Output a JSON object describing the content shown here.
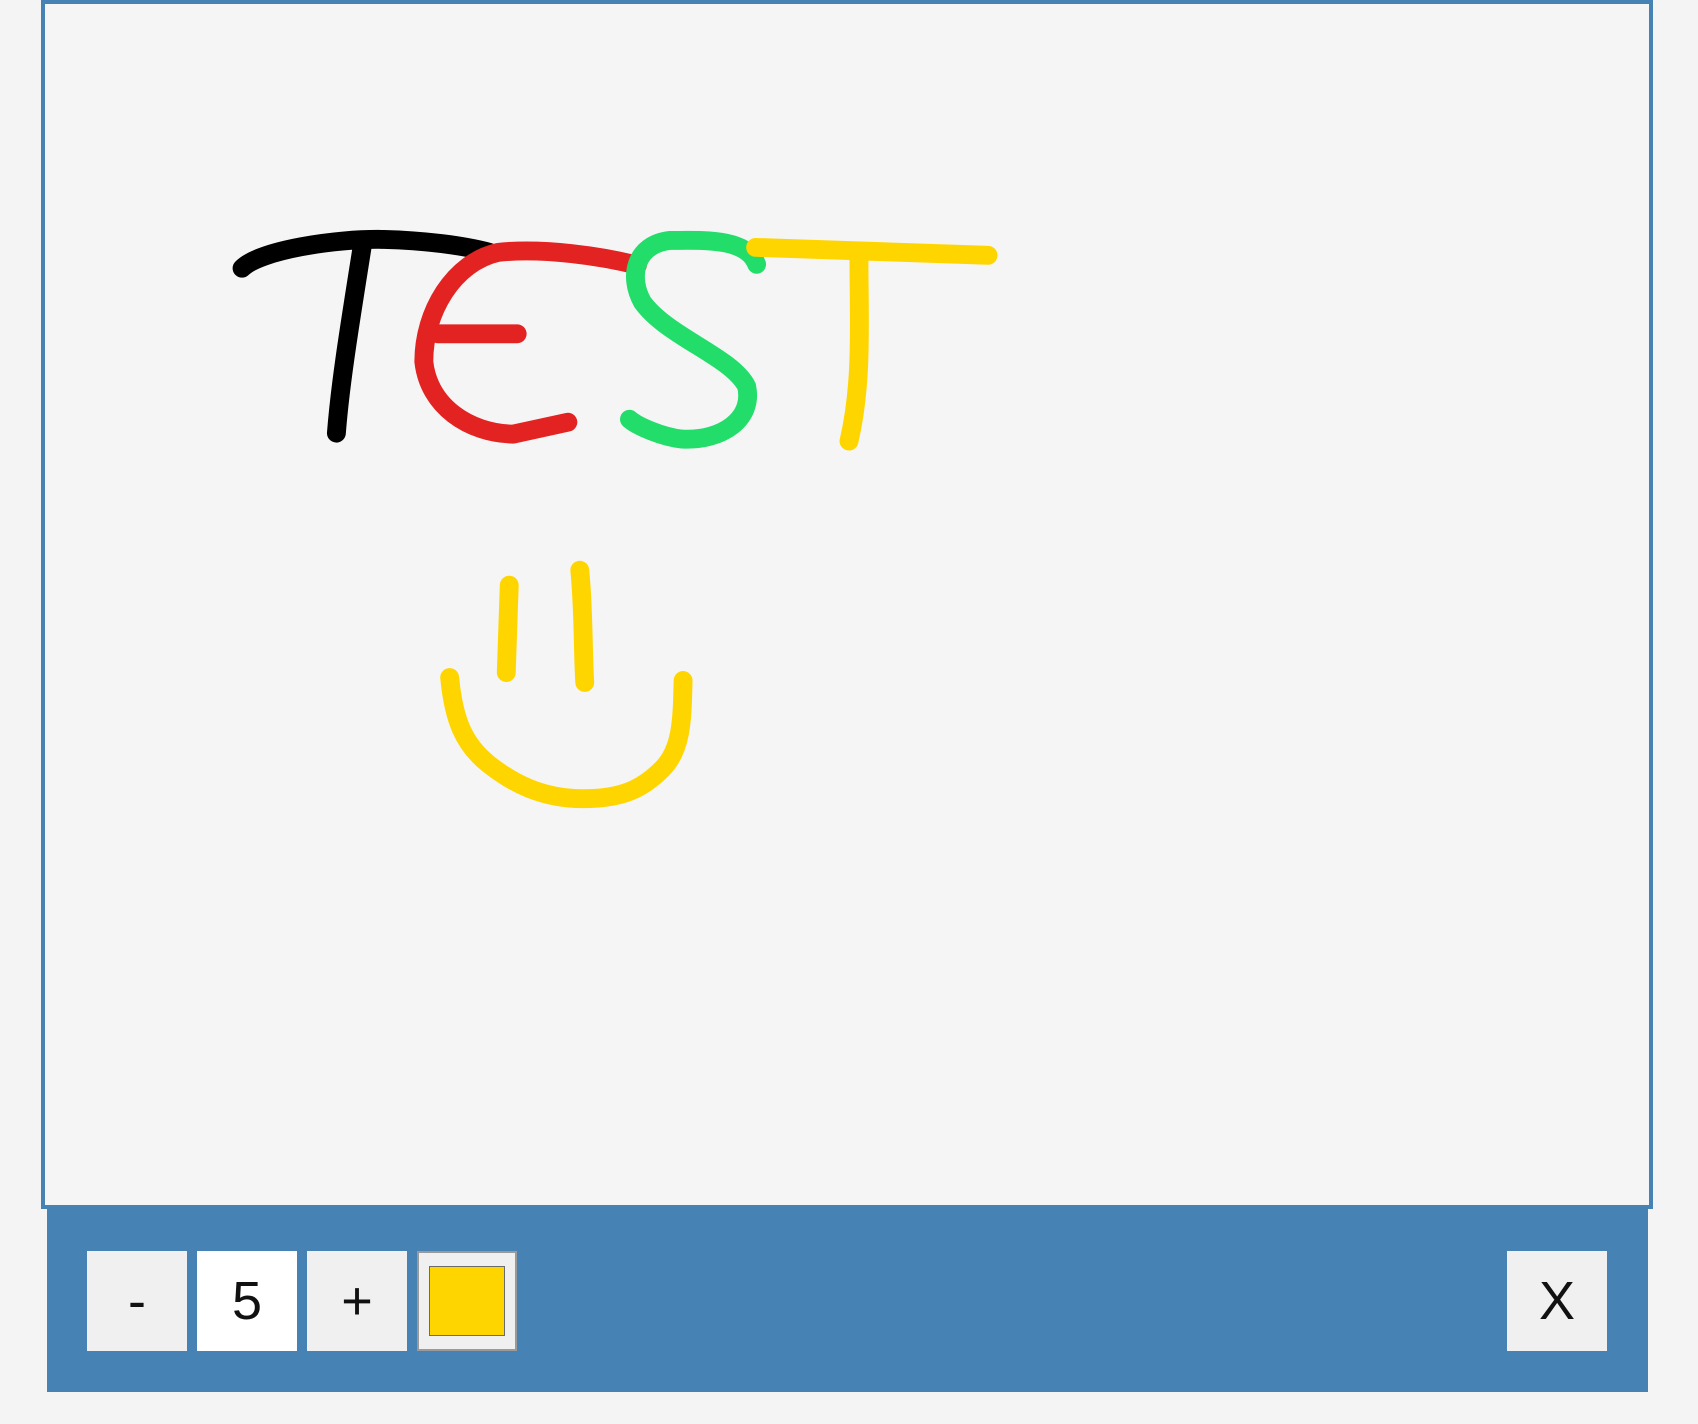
{
  "canvas": {
    "background": "#f5f5f5",
    "border_color": "#4682b4",
    "drawing_text": "TEST",
    "stroke_colors": {
      "T1": "#000000",
      "E": "#e32222",
      "S": "#22dd6a",
      "T2": "#ffd500",
      "smiley": "#ffd500"
    }
  },
  "toolbar": {
    "background": "#4682b4",
    "decrease_label": "-",
    "size_value": "5",
    "increase_label": "+",
    "current_color": "#ffd500",
    "close_label": "X"
  }
}
